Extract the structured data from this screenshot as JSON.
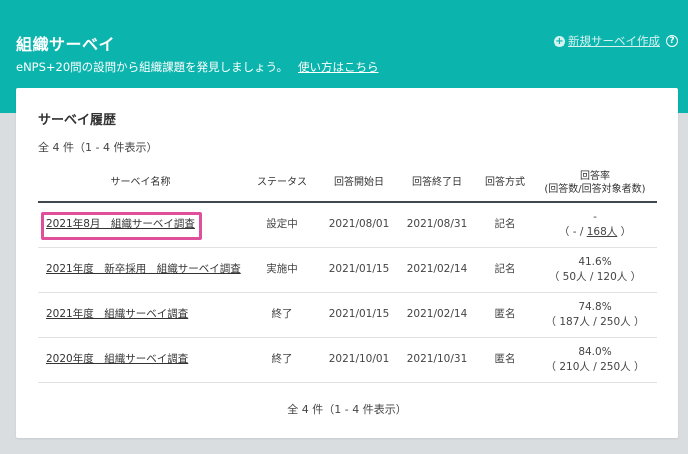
{
  "header": {
    "title": "組織サーベイ",
    "subtitle": "eNPS+20問の設問から組織課題を発見しましょう。",
    "howto_link": "使い方はこちら",
    "new_survey_label": "新規サーベイ作成",
    "help_glyph": "?"
  },
  "card": {
    "title": "サーベイ履歴",
    "count_top": "全 4 件（1 - 4 件表示）",
    "count_bottom": "全 4 件（1 - 4 件表示）"
  },
  "table": {
    "headers": {
      "name": "サーベイ名称",
      "status": "ステータス",
      "start": "回答開始日",
      "end": "回答終了日",
      "method": "回答方式",
      "rate": "回答率",
      "rate_sub": "(回答数/回答対象者数)"
    },
    "rows": [
      {
        "name": "2021年8月　組織サーベイ調査",
        "status": "設定中",
        "start": "2021/08/01",
        "end": "2021/08/31",
        "method": "記名",
        "rate": "-",
        "count_prefix": "（ - / ",
        "target": "168人",
        "count_suffix": " ）"
      },
      {
        "name": "2021年度　新卒採用　組織サーベイ調査",
        "status": "実施中",
        "start": "2021/01/15",
        "end": "2021/02/14",
        "method": "記名",
        "rate": "41.6%",
        "counts": "（ 50人 / 120人 ）"
      },
      {
        "name": "2021年度　組織サーベイ調査",
        "status": "終了",
        "start": "2021/01/15",
        "end": "2021/02/14",
        "method": "匿名",
        "rate": "74.8%",
        "counts": "（ 187人 / 250人 ）"
      },
      {
        "name": "2020年度　組織サーベイ調査",
        "status": "終了",
        "start": "2021/10/01",
        "end": "2021/10/31",
        "method": "匿名",
        "rate": "84.0%",
        "counts": "（ 210人 / 250人 ）"
      }
    ]
  },
  "colors": {
    "header_bg": "#0bb5ad",
    "highlight": "#e04f9b",
    "page_bg": "#dadde0"
  }
}
